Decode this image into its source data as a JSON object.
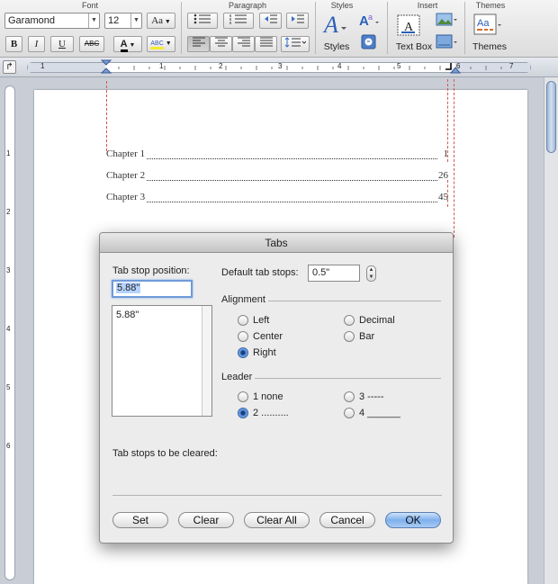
{
  "ribbon": {
    "groups": {
      "font": "Font",
      "paragraph": "Paragraph",
      "styles": "Styles",
      "insert": "Insert",
      "themes": "Themes"
    },
    "font_name": "Garamond",
    "font_size": "12",
    "change_case": "Aa",
    "bold": "B",
    "italic": "I",
    "underline": "U",
    "strikethrough": "ABC",
    "font_color": "A",
    "highlight": "ABC",
    "styles_label": "Styles",
    "text_box_label": "Text Box",
    "themes_label": "Themes"
  },
  "ruler": {
    "numbers": [
      "1",
      "1",
      "2",
      "3",
      "4",
      "5",
      "6",
      "7"
    ]
  },
  "vruler": {
    "numbers": [
      "1",
      "2",
      "3",
      "4",
      "5",
      "6"
    ]
  },
  "document": {
    "toc": [
      {
        "title": "Chapter 1",
        "page": "1"
      },
      {
        "title": "Chapter 2",
        "page": "26"
      },
      {
        "title": "Chapter 3",
        "page": "45"
      }
    ]
  },
  "dialog": {
    "title": "Tabs",
    "tab_stop_position_label": "Tab stop position:",
    "tab_stop_position_value": "5.88\"",
    "tab_stop_list": [
      "5.88\""
    ],
    "default_tab_stops_label": "Default tab stops:",
    "default_tab_stops_value": "0.5\"",
    "alignment_label": "Alignment",
    "alignment": {
      "left": "Left",
      "decimal": "Decimal",
      "center": "Center",
      "bar": "Bar",
      "right": "Right"
    },
    "alignment_selected": "Right",
    "leader_label": "Leader",
    "leader": {
      "none": "1 none",
      "dots": "2 ..........",
      "dashes": "3 -----",
      "underline": "4 ______"
    },
    "leader_selected": "2 ..........",
    "to_be_cleared_label": "Tab stops to be cleared:",
    "buttons": {
      "set": "Set",
      "clear": "Clear",
      "clear_all": "Clear All",
      "cancel": "Cancel",
      "ok": "OK"
    }
  },
  "colors": {
    "guide": "#d9534f",
    "default_button": "#7fb0ec",
    "selection": "#b5d3ff"
  }
}
